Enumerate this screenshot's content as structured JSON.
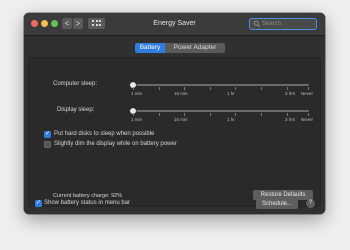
{
  "window": {
    "title": "Energy Saver"
  },
  "toolbar": {
    "back_glyph": "<",
    "forward_glyph": ">",
    "search_placeholder": "Search"
  },
  "tabs": [
    {
      "label": "Battery",
      "selected": true
    },
    {
      "label": "Power Adapter",
      "selected": false
    }
  ],
  "sliders": {
    "computer_sleep": {
      "label": "Computer sleep:",
      "ticks": [
        "1 min",
        "15 min",
        "1 hr",
        "3 hrs",
        "Never"
      ],
      "value": "1 min"
    },
    "display_sleep": {
      "label": "Display sleep:",
      "ticks": [
        "1 min",
        "15 min",
        "1 hr",
        "3 hrs",
        "Never"
      ],
      "value": "1 min"
    }
  },
  "options": [
    {
      "label": "Put hard disks to sleep when possible",
      "checked": true
    },
    {
      "label": "Slightly dim the display while on battery power",
      "checked": false
    }
  ],
  "footer": {
    "battery_charge": "Current battery charge: 92%",
    "restore_defaults": "Restore Defaults",
    "show_status_label": "Show battery status in menu bar",
    "show_status_checked": true,
    "schedule": "Schedule...",
    "help": "?"
  },
  "colors": {
    "accent": "#2f7be0",
    "window_bg": "#303030",
    "panel_bg": "#2a2a2a"
  }
}
